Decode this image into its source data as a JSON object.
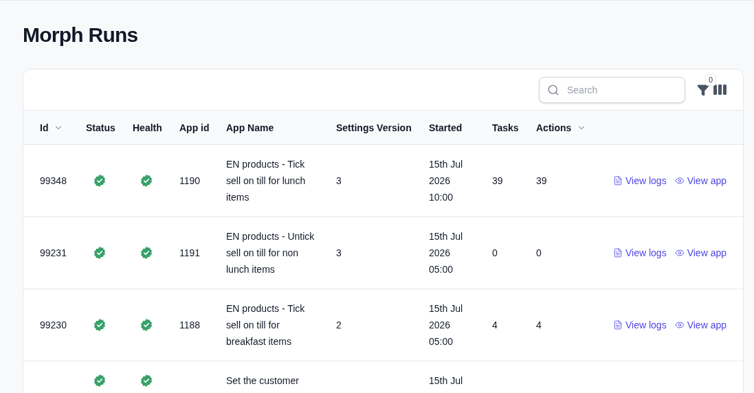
{
  "title": "Morph Runs",
  "search": {
    "placeholder": "Search"
  },
  "filter_count": "0",
  "table": {
    "columns": [
      {
        "label": "Id",
        "sortable": true
      },
      {
        "label": "Status",
        "sortable": false
      },
      {
        "label": "Health",
        "sortable": false
      },
      {
        "label": "App id",
        "sortable": false
      },
      {
        "label": "App Name",
        "sortable": false
      },
      {
        "label": "Settings Version",
        "sortable": false
      },
      {
        "label": "Started",
        "sortable": false
      },
      {
        "label": "Tasks",
        "sortable": false
      },
      {
        "label": "Actions",
        "sortable": true
      }
    ],
    "rows": [
      {
        "id": "99348",
        "status_ok": true,
        "health_ok": true,
        "app_id": "1190",
        "app_name": "EN products - Tick sell on till for lunch items",
        "settings_version": "3",
        "started": "15th Jul 2026 10:00",
        "tasks": "39",
        "actions": "39",
        "links": [
          "View logs",
          "View app"
        ]
      },
      {
        "id": "99231",
        "status_ok": true,
        "health_ok": true,
        "app_id": "1191",
        "app_name": "EN products - Untick sell on till for non lunch items",
        "settings_version": "3",
        "started": "15th Jul 2026 05:00",
        "tasks": "0",
        "actions": "0",
        "links": [
          "View logs",
          "View app"
        ]
      },
      {
        "id": "99230",
        "status_ok": true,
        "health_ok": true,
        "app_id": "1188",
        "app_name": "EN products - Tick sell on till for breakfast items",
        "settings_version": "2",
        "started": "15th Jul 2026 05:00",
        "tasks": "4",
        "actions": "4",
        "links": [
          "View logs",
          "View app"
        ]
      },
      {
        "status_ok": true,
        "health_ok": true,
        "app_name": "Set the customer",
        "started": "15th Jul"
      }
    ]
  }
}
